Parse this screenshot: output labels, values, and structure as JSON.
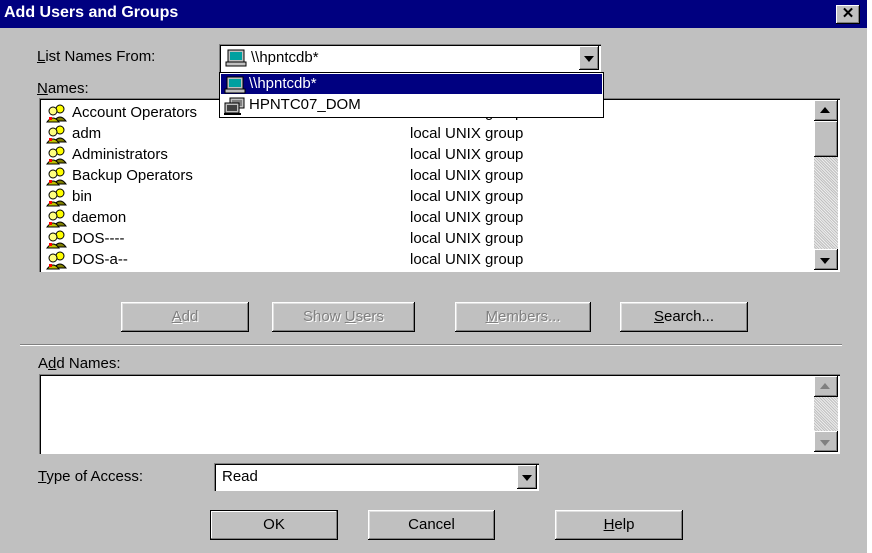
{
  "window": {
    "title": "Add Users and Groups",
    "close_glyph": "✕"
  },
  "list_names_from": {
    "label_underline": "L",
    "label_rest": "ist Names From:",
    "value": "\\\\hpntcdb*",
    "options": [
      {
        "label": "\\\\hpntcdb*",
        "selected": true,
        "icon": "computer-icon"
      },
      {
        "label": "HPNTC07_DOM",
        "selected": false,
        "icon": "domain-icon"
      }
    ]
  },
  "names": {
    "label_underline": "N",
    "label_rest": "ames:",
    "rows": [
      {
        "name": "Account Operators",
        "desc": "local UNIX group",
        "icon": "group-icon"
      },
      {
        "name": "adm",
        "desc": "local UNIX group",
        "icon": "group-icon"
      },
      {
        "name": "Administrators",
        "desc": "local UNIX group",
        "icon": "group-icon"
      },
      {
        "name": "Backup Operators",
        "desc": "local UNIX group",
        "icon": "group-icon"
      },
      {
        "name": "bin",
        "desc": "local UNIX group",
        "icon": "group-icon"
      },
      {
        "name": "daemon",
        "desc": "local UNIX group",
        "icon": "group-icon"
      },
      {
        "name": "DOS----",
        "desc": "local UNIX group",
        "icon": "group-icon"
      },
      {
        "name": "DOS-a--",
        "desc": "local UNIX group",
        "icon": "group-icon"
      }
    ]
  },
  "buttons": {
    "add": {
      "u": "A",
      "rest": "dd",
      "enabled": false
    },
    "show_users": {
      "pre": "Show ",
      "u": "U",
      "rest": "sers",
      "enabled": false
    },
    "members": {
      "u": "M",
      "rest": "embers...",
      "enabled": false
    },
    "search": {
      "u": "S",
      "rest": "earch...",
      "enabled": true
    }
  },
  "add_names": {
    "pre": "A",
    "u": "d",
    "rest": "d Names:",
    "value": ""
  },
  "type_of_access": {
    "label_underline": "T",
    "label_rest": "ype of Access:",
    "value": "Read"
  },
  "footer": {
    "ok": "OK",
    "cancel": "Cancel",
    "help_underline": "H",
    "help_rest": "elp"
  },
  "colors": {
    "titlebar": "#000080",
    "face": "#c0c0c0",
    "highlight": "#000080"
  }
}
